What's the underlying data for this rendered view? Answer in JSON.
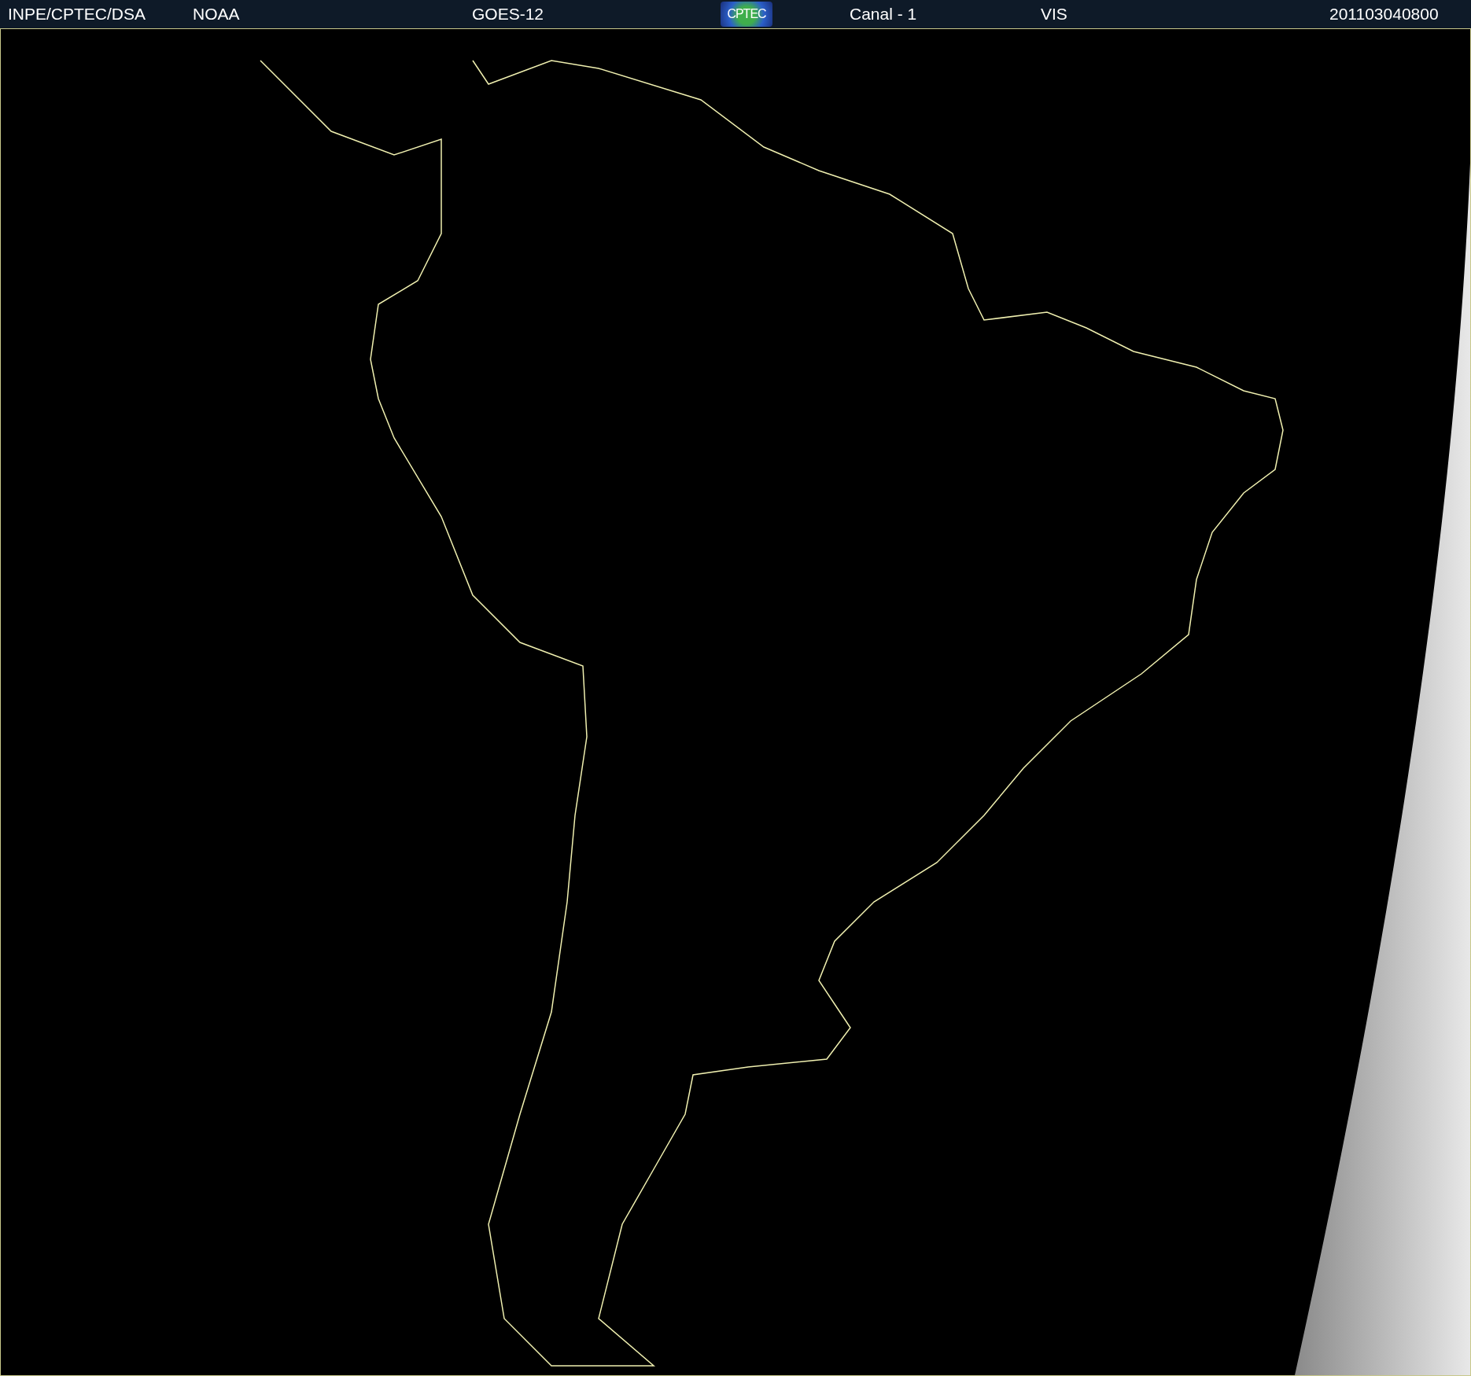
{
  "header": {
    "source": "INPE/CPTEC/DSA",
    "agency": "NOAA",
    "satellite": "GOES-12",
    "logo": "CPTEC",
    "channel": "Canal - 1",
    "band": "VIS",
    "timestamp": "201103040800"
  }
}
